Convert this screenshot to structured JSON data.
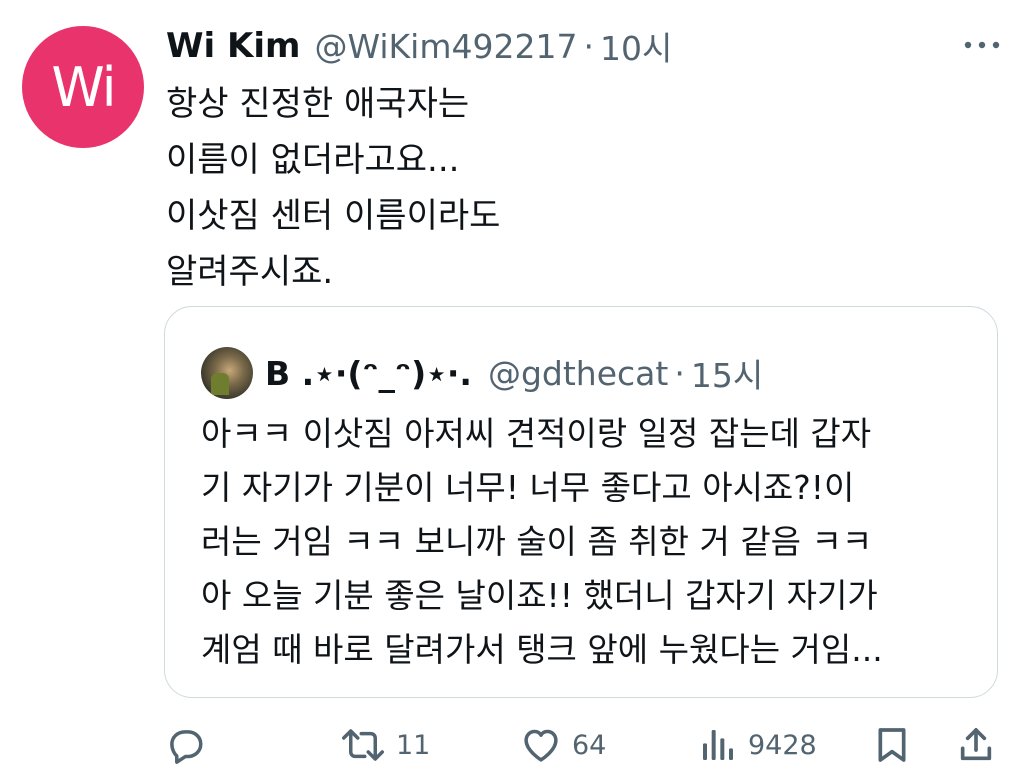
{
  "author": {
    "avatar_initials": "Wi",
    "avatar_color": "#e8336d",
    "name": "Wi Kim",
    "handle": "@WiKim492217",
    "separator": "·",
    "time": "10시"
  },
  "more_icon": "more-horizontal-icon",
  "tweet_lines": [
    "항상 진정한 애국자는",
    "이름이 없더라고요...",
    "이삿짐 센터 이름이라도",
    "알려주시죠."
  ],
  "quote": {
    "name": "B .⋆·(ᵔ_ᵔ)⋆·.",
    "handle": "@gdthecat",
    "separator": "·",
    "time": "15시",
    "lines": [
      "아ㅋㅋ 이삿짐 아저씨 견적이랑 일정 잡는데 갑자",
      "기 자기가 기분이 너무! 너무 좋다고 아시죠?!이",
      "러는 거임 ㅋㅋ 보니까 술이 좀 취한 거 같음 ㅋㅋ",
      "아 오늘 기분 좋은 날이죠!! 했더니 갑자기 자기가",
      "계엄 때 바로 달려가서 탱크 앞에 누웠다는 거임..."
    ]
  },
  "actions": {
    "reply": {
      "icon": "reply-icon",
      "count": ""
    },
    "retweet": {
      "icon": "retweet-icon",
      "count": "11"
    },
    "like": {
      "icon": "heart-icon",
      "count": "64"
    },
    "views": {
      "icon": "views-chart-icon",
      "count": "9428"
    },
    "bookmark": {
      "icon": "bookmark-icon"
    },
    "share": {
      "icon": "share-icon"
    }
  },
  "colors": {
    "text": "#0f1419",
    "muted": "#536471",
    "border": "#cfd9de"
  }
}
